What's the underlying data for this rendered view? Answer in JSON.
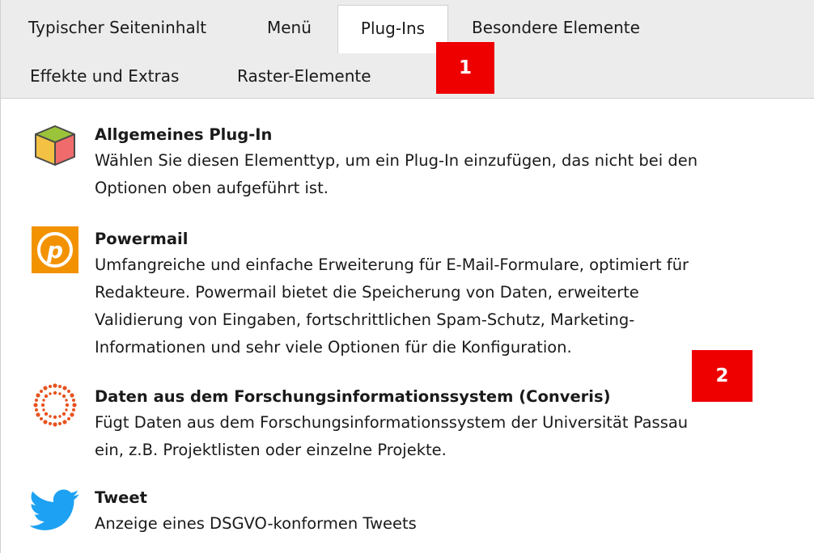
{
  "tabs": [
    {
      "label": "Typischer Seiteninhalt",
      "active": false
    },
    {
      "label": "Menü",
      "active": false
    },
    {
      "label": "Plug-Ins",
      "active": true
    },
    {
      "label": "Besondere Elemente",
      "active": false
    },
    {
      "label": "Effekte und Extras",
      "active": false
    },
    {
      "label": "Raster-Elemente",
      "active": false
    }
  ],
  "badges": {
    "first": "1",
    "second": "2"
  },
  "items": [
    {
      "title": "Allgemeines Plug-In",
      "desc_lines": [
        "Wählen Sie diesen Elementtyp, um ein Plug-In einzufügen, das nicht bei den",
        "Optionen oben aufgeführt ist."
      ],
      "icon": "generic-plugin-cube-icon"
    },
    {
      "title": "Powermail",
      "desc_lines": [
        "Umfangreiche und einfache Erweiterung für E-Mail-Formulare, optimiert für",
        "Redakteure. Powermail bietet die Speicherung von Daten, erweiterte",
        "Validierung von Eingaben, fortschrittlichen Spam-Schutz, Marketing-",
        "Informationen und sehr viele Optionen für die Konfiguration."
      ],
      "icon": "powermail-icon"
    },
    {
      "title": "Daten aus dem Forschungsinformationssystem (Converis)",
      "desc_lines": [
        "Fügt Daten aus dem Forschungsinformationssystem der Universität Passau",
        "ein, z.B. Projektlisten oder einzelne Projekte."
      ],
      "icon": "converis-icon"
    },
    {
      "title": "Tweet",
      "desc_lines": [
        "Anzeige eines DSGVO-konformen Tweets"
      ],
      "icon": "twitter-bird-icon"
    }
  ],
  "colors": {
    "badge": "#ee0000",
    "powermail": "#f39200",
    "converis": "#e8531f",
    "twitter": "#1da1f2"
  }
}
